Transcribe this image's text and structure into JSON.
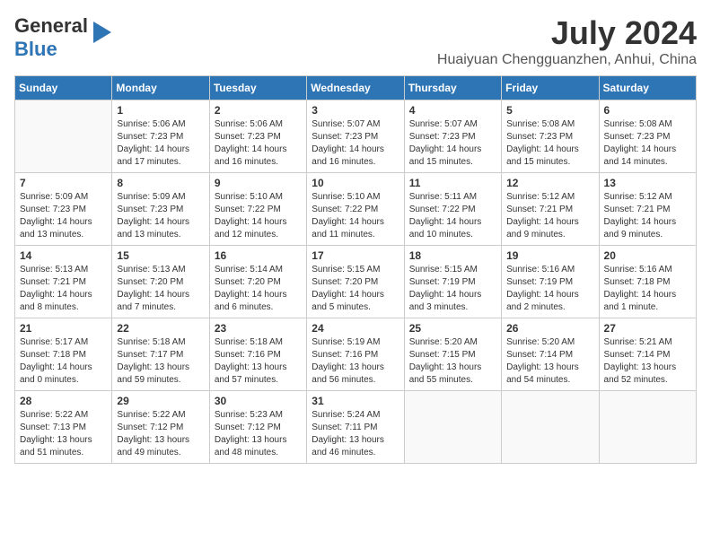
{
  "header": {
    "logo": {
      "general": "General",
      "blue": "Blue"
    },
    "month_year": "July 2024",
    "location": "Huaiyuan Chengguanzhen, Anhui, China"
  },
  "calendar": {
    "weekdays": [
      "Sunday",
      "Monday",
      "Tuesday",
      "Wednesday",
      "Thursday",
      "Friday",
      "Saturday"
    ],
    "weeks": [
      [
        {
          "day": "",
          "info": ""
        },
        {
          "day": "1",
          "info": "Sunrise: 5:06 AM\nSunset: 7:23 PM\nDaylight: 14 hours\nand 17 minutes."
        },
        {
          "day": "2",
          "info": "Sunrise: 5:06 AM\nSunset: 7:23 PM\nDaylight: 14 hours\nand 16 minutes."
        },
        {
          "day": "3",
          "info": "Sunrise: 5:07 AM\nSunset: 7:23 PM\nDaylight: 14 hours\nand 16 minutes."
        },
        {
          "day": "4",
          "info": "Sunrise: 5:07 AM\nSunset: 7:23 PM\nDaylight: 14 hours\nand 15 minutes."
        },
        {
          "day": "5",
          "info": "Sunrise: 5:08 AM\nSunset: 7:23 PM\nDaylight: 14 hours\nand 15 minutes."
        },
        {
          "day": "6",
          "info": "Sunrise: 5:08 AM\nSunset: 7:23 PM\nDaylight: 14 hours\nand 14 minutes."
        }
      ],
      [
        {
          "day": "7",
          "info": "Sunrise: 5:09 AM\nSunset: 7:23 PM\nDaylight: 14 hours\nand 13 minutes."
        },
        {
          "day": "8",
          "info": "Sunrise: 5:09 AM\nSunset: 7:23 PM\nDaylight: 14 hours\nand 13 minutes."
        },
        {
          "day": "9",
          "info": "Sunrise: 5:10 AM\nSunset: 7:22 PM\nDaylight: 14 hours\nand 12 minutes."
        },
        {
          "day": "10",
          "info": "Sunrise: 5:10 AM\nSunset: 7:22 PM\nDaylight: 14 hours\nand 11 minutes."
        },
        {
          "day": "11",
          "info": "Sunrise: 5:11 AM\nSunset: 7:22 PM\nDaylight: 14 hours\nand 10 minutes."
        },
        {
          "day": "12",
          "info": "Sunrise: 5:12 AM\nSunset: 7:21 PM\nDaylight: 14 hours\nand 9 minutes."
        },
        {
          "day": "13",
          "info": "Sunrise: 5:12 AM\nSunset: 7:21 PM\nDaylight: 14 hours\nand 9 minutes."
        }
      ],
      [
        {
          "day": "14",
          "info": "Sunrise: 5:13 AM\nSunset: 7:21 PM\nDaylight: 14 hours\nand 8 minutes."
        },
        {
          "day": "15",
          "info": "Sunrise: 5:13 AM\nSunset: 7:20 PM\nDaylight: 14 hours\nand 7 minutes."
        },
        {
          "day": "16",
          "info": "Sunrise: 5:14 AM\nSunset: 7:20 PM\nDaylight: 14 hours\nand 6 minutes."
        },
        {
          "day": "17",
          "info": "Sunrise: 5:15 AM\nSunset: 7:20 PM\nDaylight: 14 hours\nand 5 minutes."
        },
        {
          "day": "18",
          "info": "Sunrise: 5:15 AM\nSunset: 7:19 PM\nDaylight: 14 hours\nand 3 minutes."
        },
        {
          "day": "19",
          "info": "Sunrise: 5:16 AM\nSunset: 7:19 PM\nDaylight: 14 hours\nand 2 minutes."
        },
        {
          "day": "20",
          "info": "Sunrise: 5:16 AM\nSunset: 7:18 PM\nDaylight: 14 hours\nand 1 minute."
        }
      ],
      [
        {
          "day": "21",
          "info": "Sunrise: 5:17 AM\nSunset: 7:18 PM\nDaylight: 14 hours\nand 0 minutes."
        },
        {
          "day": "22",
          "info": "Sunrise: 5:18 AM\nSunset: 7:17 PM\nDaylight: 13 hours\nand 59 minutes."
        },
        {
          "day": "23",
          "info": "Sunrise: 5:18 AM\nSunset: 7:16 PM\nDaylight: 13 hours\nand 57 minutes."
        },
        {
          "day": "24",
          "info": "Sunrise: 5:19 AM\nSunset: 7:16 PM\nDaylight: 13 hours\nand 56 minutes."
        },
        {
          "day": "25",
          "info": "Sunrise: 5:20 AM\nSunset: 7:15 PM\nDaylight: 13 hours\nand 55 minutes."
        },
        {
          "day": "26",
          "info": "Sunrise: 5:20 AM\nSunset: 7:14 PM\nDaylight: 13 hours\nand 54 minutes."
        },
        {
          "day": "27",
          "info": "Sunrise: 5:21 AM\nSunset: 7:14 PM\nDaylight: 13 hours\nand 52 minutes."
        }
      ],
      [
        {
          "day": "28",
          "info": "Sunrise: 5:22 AM\nSunset: 7:13 PM\nDaylight: 13 hours\nand 51 minutes."
        },
        {
          "day": "29",
          "info": "Sunrise: 5:22 AM\nSunset: 7:12 PM\nDaylight: 13 hours\nand 49 minutes."
        },
        {
          "day": "30",
          "info": "Sunrise: 5:23 AM\nSunset: 7:12 PM\nDaylight: 13 hours\nand 48 minutes."
        },
        {
          "day": "31",
          "info": "Sunrise: 5:24 AM\nSunset: 7:11 PM\nDaylight: 13 hours\nand 46 minutes."
        },
        {
          "day": "",
          "info": ""
        },
        {
          "day": "",
          "info": ""
        },
        {
          "day": "",
          "info": ""
        }
      ]
    ]
  }
}
